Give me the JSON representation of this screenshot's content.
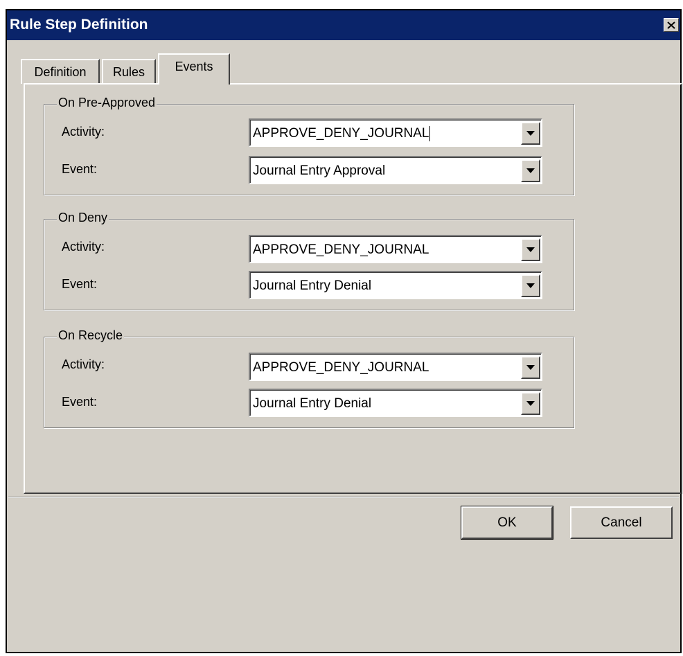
{
  "window": {
    "title": "Rule Step Definition"
  },
  "tabs": [
    {
      "label": "Definition",
      "active": false
    },
    {
      "label": "Rules",
      "active": false
    },
    {
      "label": "Events",
      "active": true
    }
  ],
  "groups": {
    "pre_approved": {
      "legend": "On Pre-Approved",
      "activity_label": "Activity:",
      "activity_value": "APPROVE_DENY_JOURNAL",
      "event_label": "Event:",
      "event_value": "Journal Entry Approval"
    },
    "deny": {
      "legend": "On Deny",
      "activity_label": "Activity:",
      "activity_value": "APPROVE_DENY_JOURNAL",
      "event_label": "Event:",
      "event_value": "Journal Entry Denial"
    },
    "recycle": {
      "legend": "On Recycle",
      "activity_label": "Activity:",
      "activity_value": "APPROVE_DENY_JOURNAL",
      "event_label": "Event:",
      "event_value": "Journal Entry Denial"
    }
  },
  "buttons": {
    "ok": "OK",
    "cancel": "Cancel"
  },
  "icons": {
    "close": "close-icon",
    "dropdown": "chevron-down-icon"
  },
  "colors": {
    "titlebar": "#0a246a",
    "face": "#d4d0c8"
  }
}
